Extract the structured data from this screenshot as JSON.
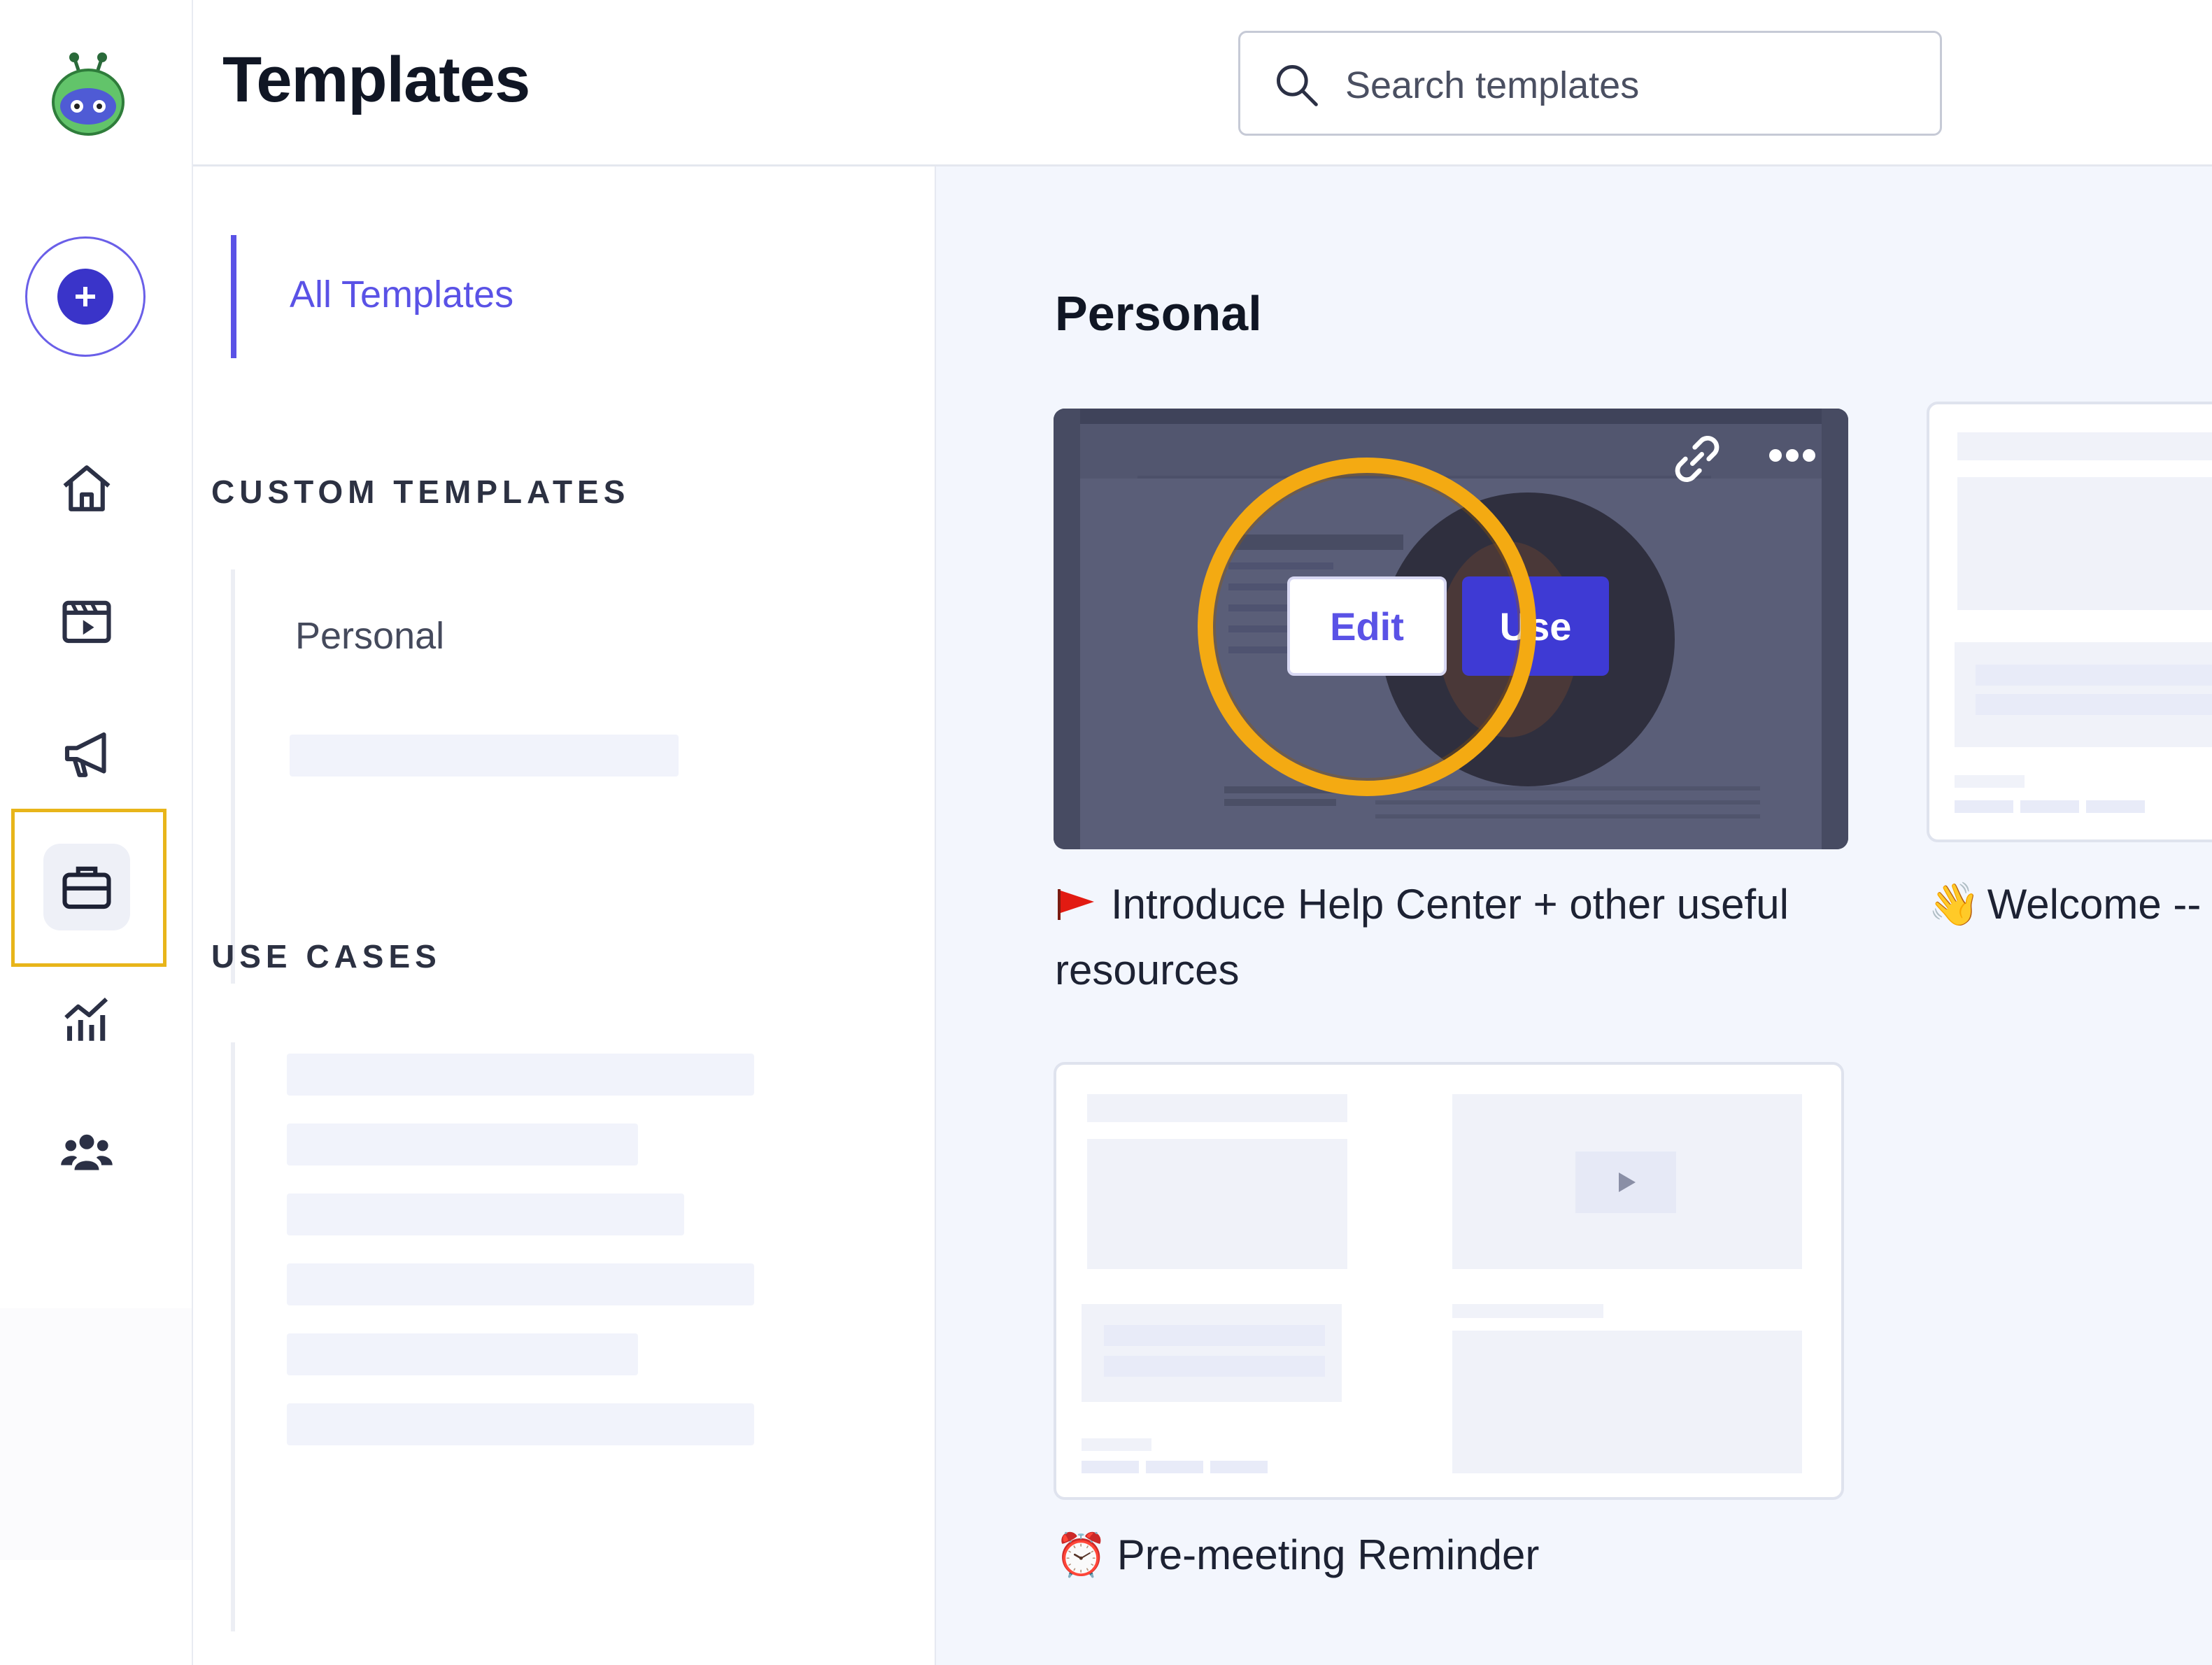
{
  "header": {
    "title": "Templates",
    "search_placeholder": "Search templates"
  },
  "rail": {
    "items": [
      {
        "name": "home",
        "icon": "home-icon"
      },
      {
        "name": "videos",
        "icon": "video-library-icon"
      },
      {
        "name": "campaigns",
        "icon": "megaphone-icon"
      },
      {
        "name": "templates",
        "icon": "briefcase-icon",
        "active": true
      },
      {
        "name": "analytics",
        "icon": "analytics-chart-icon"
      },
      {
        "name": "team",
        "icon": "team-icon"
      }
    ],
    "highlight_color": "#e8b51a"
  },
  "sidebar": {
    "all_templates": "All Templates",
    "custom_heading": "CUSTOM TEMPLATES",
    "custom_items": [
      "Personal"
    ],
    "use_cases_heading": "USE CASES"
  },
  "main": {
    "section_title": "Personal",
    "cards": [
      {
        "emoji": "🚩",
        "title": "Introduce Help Center + other useful resources",
        "has_video": true
      },
      {
        "emoji": "👋",
        "title": "Welcome --",
        "has_video": false
      },
      {
        "emoji": "⏰",
        "title": "Pre-meeting Reminder",
        "has_video": false
      }
    ],
    "edit_label": "Edit",
    "use_label": "Use"
  },
  "colors": {
    "accent": "#5a52e6",
    "primary_button": "#3e3ad4",
    "highlight_ring": "#f4aa12",
    "main_bg": "#f3f6fd"
  }
}
